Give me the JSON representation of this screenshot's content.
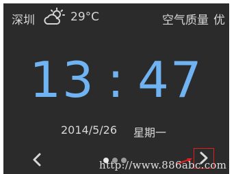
{
  "header": {
    "city": "深圳",
    "weather_icon": "partly-sunny-icon",
    "temperature": "29°C",
    "air_quality_label": "空气质量",
    "air_quality_value": "优"
  },
  "clock": {
    "hours": "13",
    "separator": ":",
    "minutes": "47"
  },
  "date": {
    "date_text": "2014/5/26",
    "weekday": "星期一"
  },
  "pager": {
    "pages": 3,
    "active_page": 1,
    "prev_icon": "chevron-left-icon",
    "next_icon": "chevron-right-icon"
  },
  "watermark": {
    "text": "http://www.886abc.com"
  },
  "colors": {
    "background": "#2b2b2b",
    "time": "#6fb3f2",
    "text": "#d8d8d8",
    "highlight": "#e02020"
  }
}
